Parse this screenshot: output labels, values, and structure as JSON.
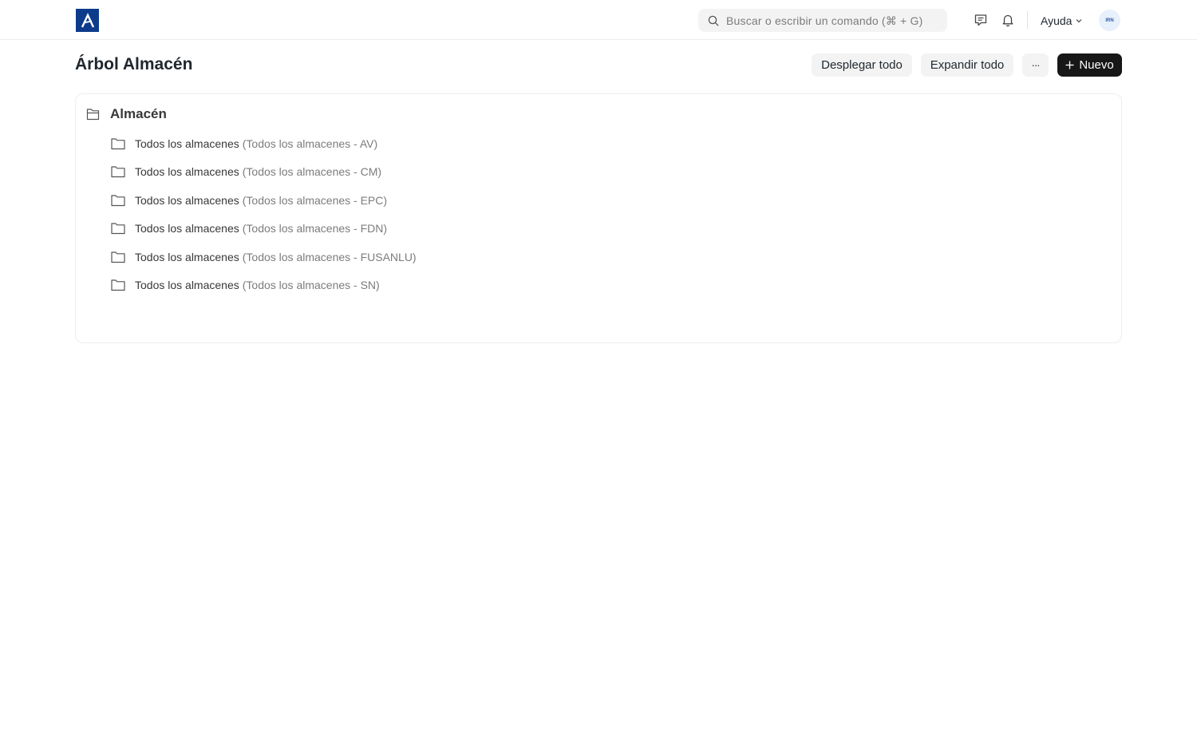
{
  "navbar": {
    "search_placeholder": "Buscar o escribir un comando (⌘ + G)",
    "help_label": "Ayuda",
    "avatar_initials": "IRN"
  },
  "page": {
    "title": "Árbol Almacén",
    "collapse_all_label": "Desplegar todo",
    "expand_all_label": "Expandir todo",
    "more_label": "···",
    "new_label": "Nuevo"
  },
  "tree": {
    "root_label": "Almacén",
    "children": [
      {
        "name": "Todos los almacenes",
        "desc": "(Todos los almacenes - AV)"
      },
      {
        "name": "Todos los almacenes",
        "desc": "(Todos los almacenes - CM)"
      },
      {
        "name": "Todos los almacenes",
        "desc": "(Todos los almacenes - EPC)"
      },
      {
        "name": "Todos los almacenes",
        "desc": "(Todos los almacenes - FDN)"
      },
      {
        "name": "Todos los almacenes",
        "desc": "(Todos los almacenes - FUSANLU)"
      },
      {
        "name": "Todos los almacenes",
        "desc": "(Todos los almacenes - SN)"
      }
    ]
  },
  "colors": {
    "brand": "#0d3b8c",
    "primary_button": "#171717"
  }
}
